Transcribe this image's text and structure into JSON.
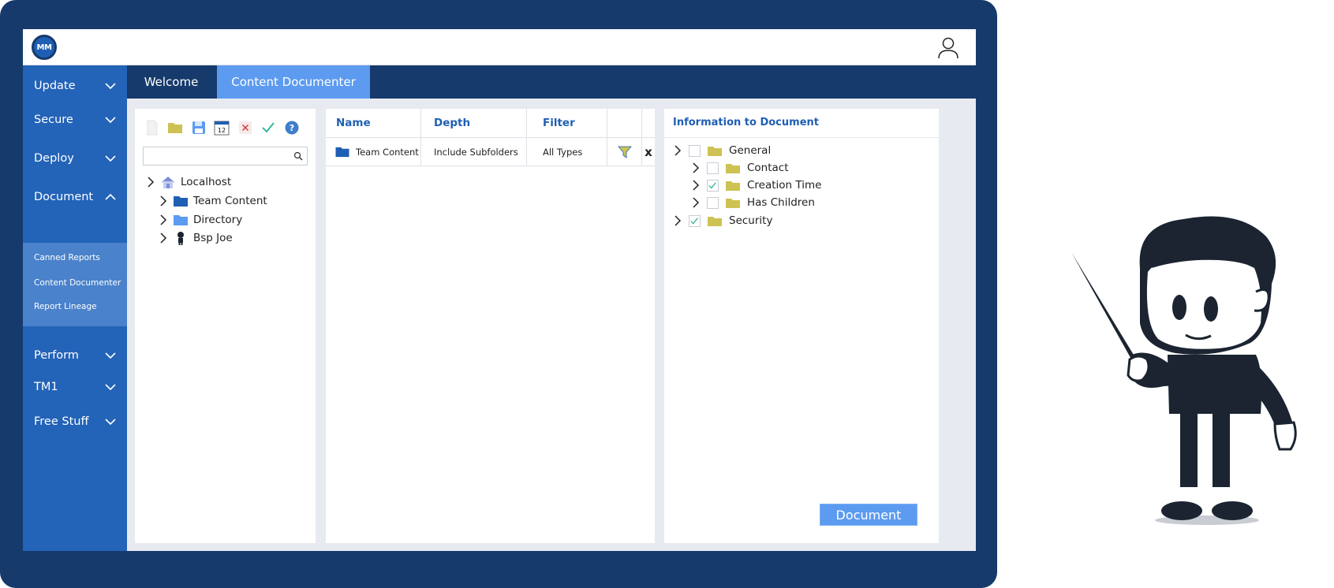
{
  "app": {
    "logo_text": "MM"
  },
  "sidebar": {
    "items": [
      {
        "label": "Update"
      },
      {
        "label": "Secure"
      },
      {
        "label": "Deploy"
      },
      {
        "label": "Document"
      },
      {
        "label": "Perform"
      },
      {
        "label": "TM1"
      },
      {
        "label": "Free Stuff"
      }
    ],
    "document_subitems": [
      {
        "label": "Canned Reports"
      },
      {
        "label": "Content Documenter"
      },
      {
        "label": "Report Lineage"
      }
    ]
  },
  "tabs": [
    {
      "label": "Welcome",
      "active": false
    },
    {
      "label": "Content Documenter",
      "active": true
    }
  ],
  "toolbar": {
    "icons": [
      "new-file-icon",
      "folder-icon",
      "save-icon",
      "calendar-icon",
      "delete-icon",
      "check-icon",
      "help-icon"
    ],
    "calendar_day": "12",
    "help_glyph": "?"
  },
  "search": {
    "placeholder": "",
    "value": ""
  },
  "tree": [
    {
      "label": "Localhost",
      "icon": "house-icon"
    },
    {
      "label": "Team Content",
      "icon": "folder-dark-icon"
    },
    {
      "label": "Directory",
      "icon": "folder-light-icon"
    },
    {
      "label": "Bsp Joe",
      "icon": "person-icon"
    }
  ],
  "grid": {
    "columns": [
      "Name",
      "Depth",
      "Filter",
      "",
      ""
    ],
    "rows": [
      {
        "name": "Team Content",
        "depth": "Include Subfolders",
        "filter": "All Types",
        "remove_glyph": "x"
      }
    ]
  },
  "info": {
    "title": "Information to Document",
    "items": [
      {
        "label": "General",
        "level": 0,
        "checked": false
      },
      {
        "label": "Contact",
        "level": 1,
        "checked": false
      },
      {
        "label": "Creation Time",
        "level": 1,
        "checked": true
      },
      {
        "label": "Has Children",
        "level": 1,
        "checked": false
      },
      {
        "label": "Security",
        "level": 0,
        "checked": true
      }
    ],
    "button_label": "Document"
  },
  "colors": {
    "frame": "#163a6b",
    "sidebar": "#2363b8",
    "accent": "#5c9bf0",
    "folder_yellow": "#cdc253",
    "heading_blue": "#1f5fb3"
  }
}
